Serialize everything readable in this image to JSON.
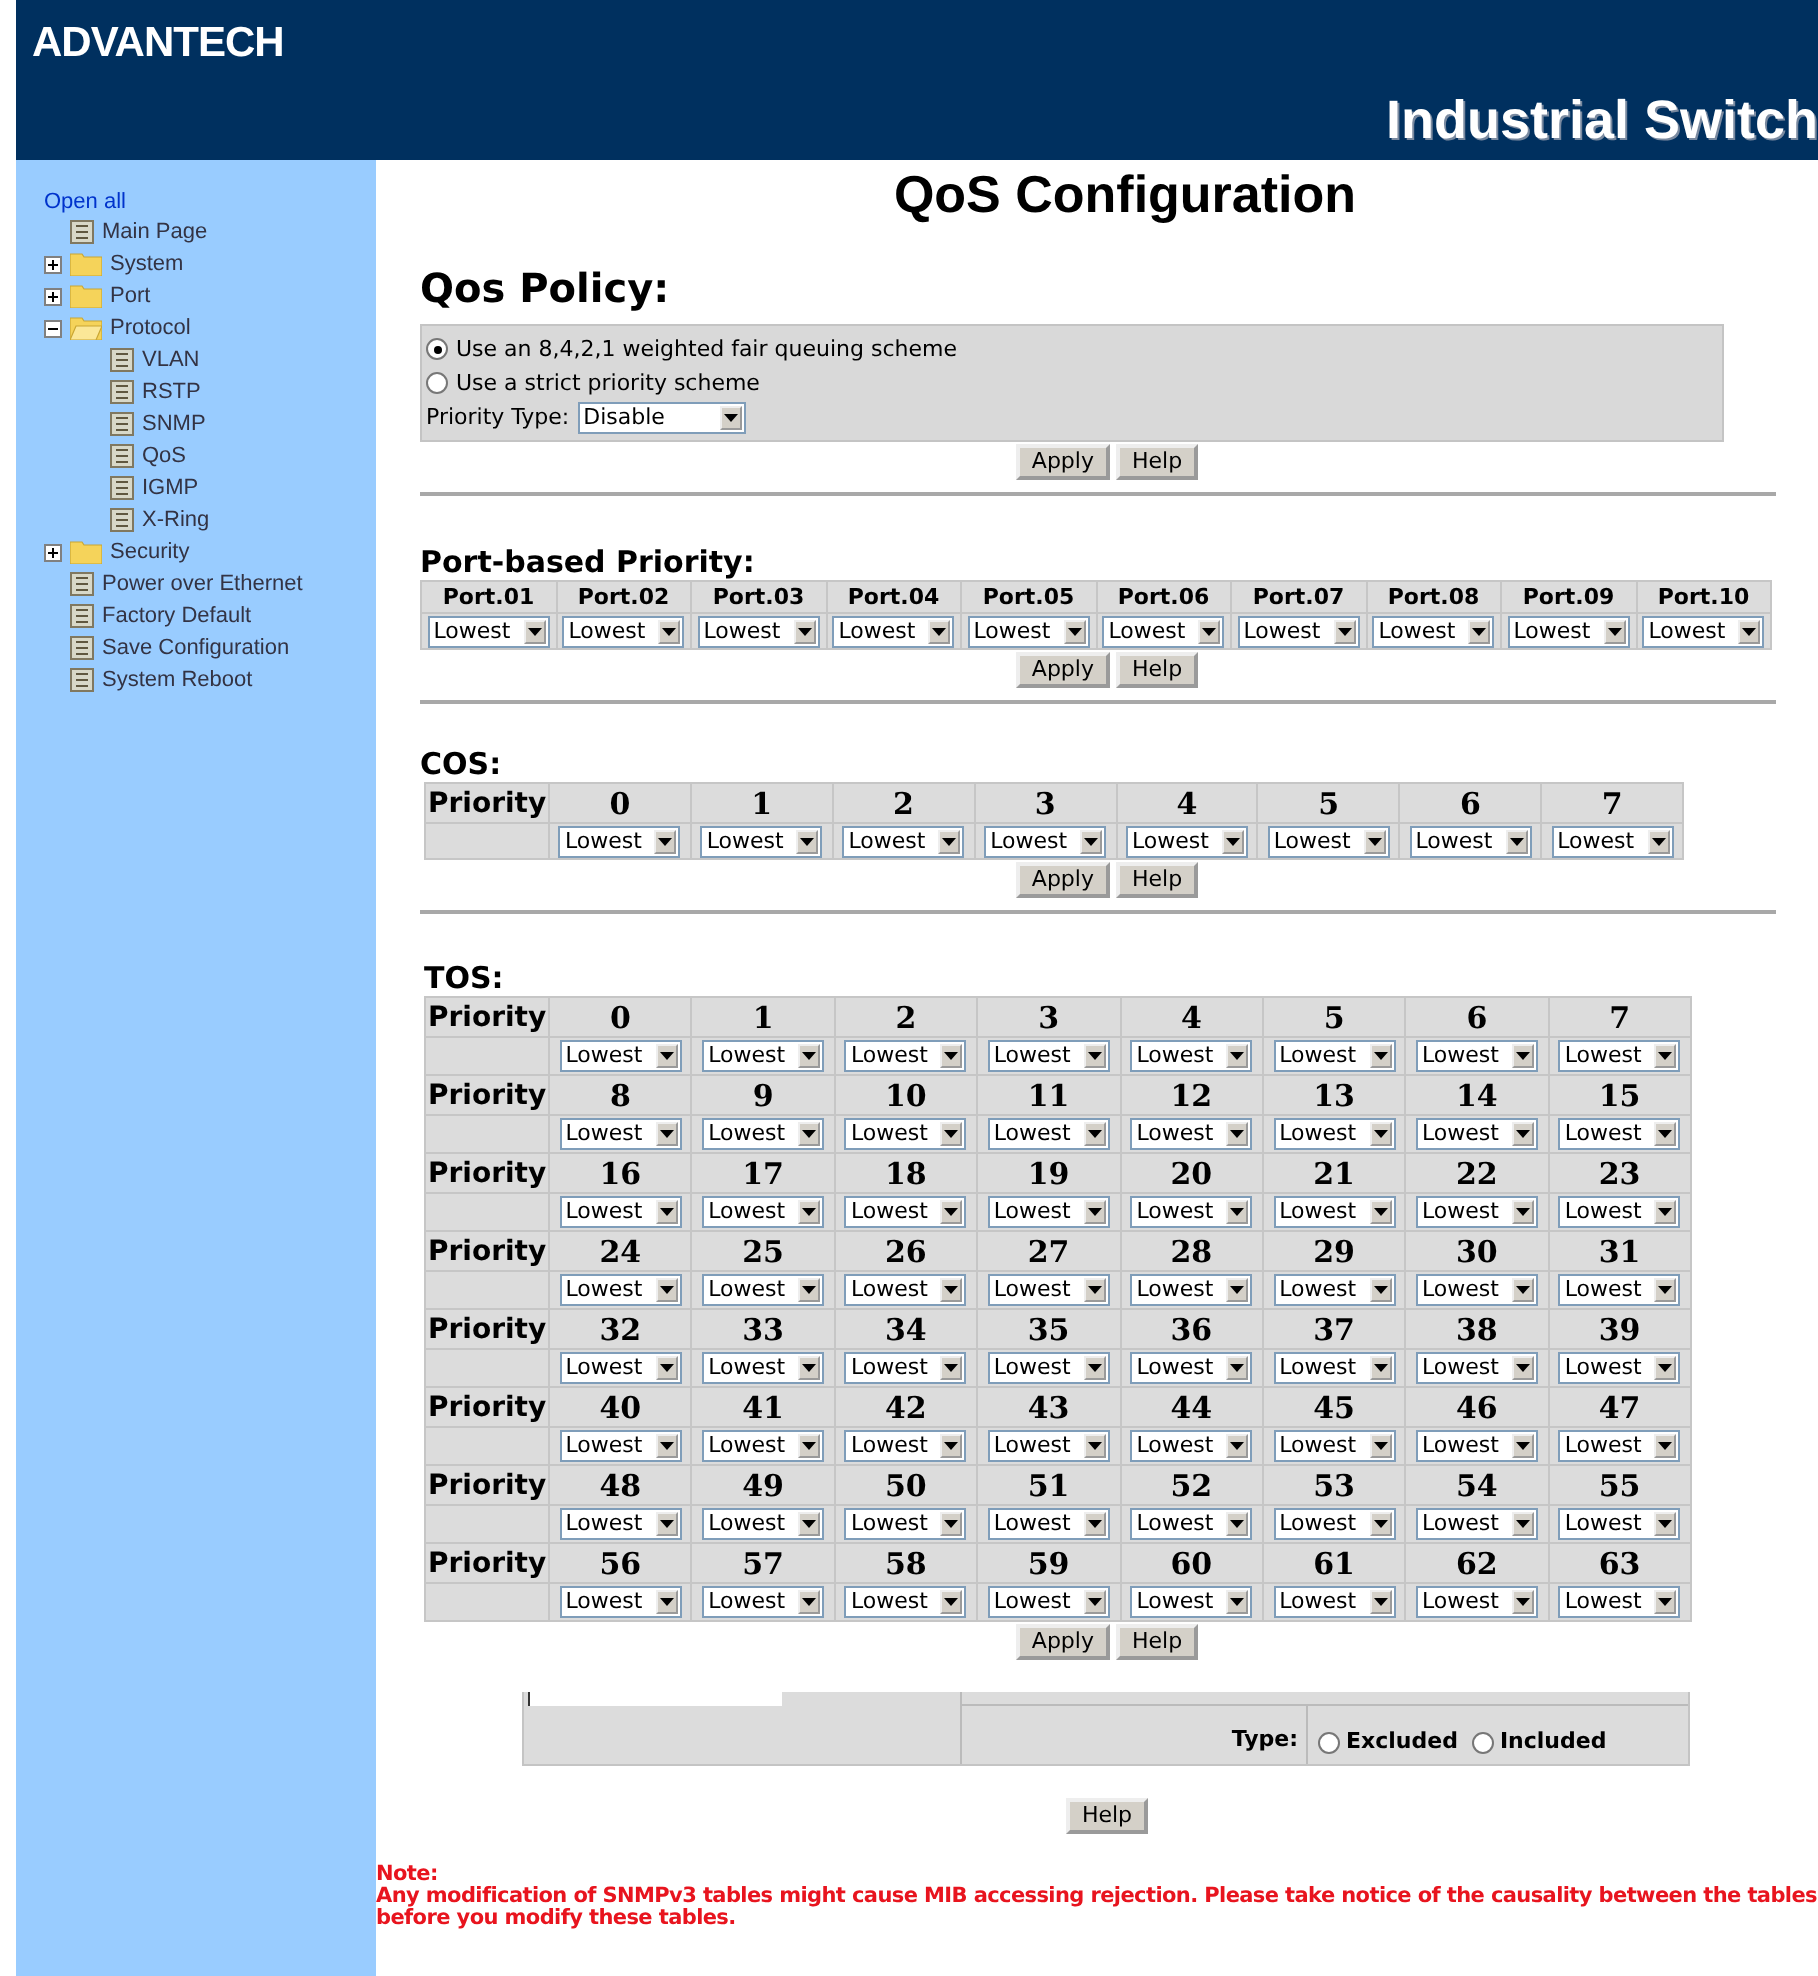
{
  "header": {
    "logo": "ADVANTECH",
    "title": "Industrial Switch"
  },
  "sidebar": {
    "open_all": "Open all",
    "items": [
      {
        "kind": "page",
        "label": "Main Page"
      },
      {
        "kind": "folder",
        "label": "System",
        "expanded": false
      },
      {
        "kind": "folder",
        "label": "Port",
        "expanded": false
      },
      {
        "kind": "folder",
        "label": "Protocol",
        "expanded": true,
        "children": [
          {
            "kind": "page",
            "label": "VLAN"
          },
          {
            "kind": "page",
            "label": "RSTP"
          },
          {
            "kind": "page",
            "label": "SNMP"
          },
          {
            "kind": "page",
            "label": "QoS"
          },
          {
            "kind": "page",
            "label": "IGMP"
          },
          {
            "kind": "page",
            "label": "X-Ring"
          }
        ]
      },
      {
        "kind": "folder",
        "label": "Security",
        "expanded": false
      },
      {
        "kind": "page",
        "label": "Power over Ethernet"
      },
      {
        "kind": "page",
        "label": "Factory Default"
      },
      {
        "kind": "page",
        "label": "Save Configuration"
      },
      {
        "kind": "page",
        "label": "System Reboot"
      }
    ]
  },
  "page_title": "QoS Configuration",
  "qos_policy": {
    "heading": "Qos Policy:",
    "options": [
      {
        "label": "Use an 8,4,2,1 weighted fair queuing scheme",
        "selected": true
      },
      {
        "label": "Use a strict priority scheme",
        "selected": false
      }
    ],
    "priority_type_label": "Priority Type:",
    "priority_type": "Disable",
    "buttons": [
      "Apply",
      "Help"
    ]
  },
  "port_priority": {
    "heading": "Port-based Priority:",
    "ports": [
      {
        "label": "Port.01",
        "value": "Lowest"
      },
      {
        "label": "Port.02",
        "value": "Lowest"
      },
      {
        "label": "Port.03",
        "value": "Lowest"
      },
      {
        "label": "Port.04",
        "value": "Lowest"
      },
      {
        "label": "Port.05",
        "value": "Lowest"
      },
      {
        "label": "Port.06",
        "value": "Lowest"
      },
      {
        "label": "Port.07",
        "value": "Lowest"
      },
      {
        "label": "Port.08",
        "value": "Lowest"
      },
      {
        "label": "Port.09",
        "value": "Lowest"
      },
      {
        "label": "Port.10",
        "value": "Lowest"
      }
    ],
    "buttons": [
      "Apply",
      "Help"
    ]
  },
  "cos": {
    "heading": "COS:",
    "row_label": "Priority",
    "entries": [
      {
        "label": "0",
        "value": "Lowest"
      },
      {
        "label": "1",
        "value": "Lowest"
      },
      {
        "label": "2",
        "value": "Lowest"
      },
      {
        "label": "3",
        "value": "Lowest"
      },
      {
        "label": "4",
        "value": "Lowest"
      },
      {
        "label": "5",
        "value": "Lowest"
      },
      {
        "label": "6",
        "value": "Lowest"
      },
      {
        "label": "7",
        "value": "Lowest"
      }
    ],
    "buttons": [
      "Apply",
      "Help"
    ]
  },
  "tos": {
    "heading": "TOS:",
    "rows": [
      {
        "label": "Priority",
        "entries": [
          {
            "label": "0",
            "value": "Lowest"
          },
          {
            "label": "1",
            "value": "Lowest"
          },
          {
            "label": "2",
            "value": "Lowest"
          },
          {
            "label": "3",
            "value": "Lowest"
          },
          {
            "label": "4",
            "value": "Lowest"
          },
          {
            "label": "5",
            "value": "Lowest"
          },
          {
            "label": "6",
            "value": "Lowest"
          },
          {
            "label": "7",
            "value": "Lowest"
          }
        ]
      },
      {
        "label": "Priority",
        "entries": [
          {
            "label": "8",
            "value": "Lowest"
          },
          {
            "label": "9",
            "value": "Lowest"
          },
          {
            "label": "10",
            "value": "Lowest"
          },
          {
            "label": "11",
            "value": "Lowest"
          },
          {
            "label": "12",
            "value": "Lowest"
          },
          {
            "label": "13",
            "value": "Lowest"
          },
          {
            "label": "14",
            "value": "Lowest"
          },
          {
            "label": "15",
            "value": "Lowest"
          }
        ]
      },
      {
        "label": "Priority",
        "entries": [
          {
            "label": "16",
            "value": "Lowest"
          },
          {
            "label": "17",
            "value": "Lowest"
          },
          {
            "label": "18",
            "value": "Lowest"
          },
          {
            "label": "19",
            "value": "Lowest"
          },
          {
            "label": "20",
            "value": "Lowest"
          },
          {
            "label": "21",
            "value": "Lowest"
          },
          {
            "label": "22",
            "value": "Lowest"
          },
          {
            "label": "23",
            "value": "Lowest"
          }
        ]
      },
      {
        "label": "Priority",
        "entries": [
          {
            "label": "24",
            "value": "Lowest"
          },
          {
            "label": "25",
            "value": "Lowest"
          },
          {
            "label": "26",
            "value": "Lowest"
          },
          {
            "label": "27",
            "value": "Lowest"
          },
          {
            "label": "28",
            "value": "Lowest"
          },
          {
            "label": "29",
            "value": "Lowest"
          },
          {
            "label": "30",
            "value": "Lowest"
          },
          {
            "label": "31",
            "value": "Lowest"
          }
        ]
      },
      {
        "label": "Priority",
        "entries": [
          {
            "label": "32",
            "value": "Lowest"
          },
          {
            "label": "33",
            "value": "Lowest"
          },
          {
            "label": "34",
            "value": "Lowest"
          },
          {
            "label": "35",
            "value": "Lowest"
          },
          {
            "label": "36",
            "value": "Lowest"
          },
          {
            "label": "37",
            "value": "Lowest"
          },
          {
            "label": "38",
            "value": "Lowest"
          },
          {
            "label": "39",
            "value": "Lowest"
          }
        ]
      },
      {
        "label": "Priority",
        "entries": [
          {
            "label": "40",
            "value": "Lowest"
          },
          {
            "label": "41",
            "value": "Lowest"
          },
          {
            "label": "42",
            "value": "Lowest"
          },
          {
            "label": "43",
            "value": "Lowest"
          },
          {
            "label": "44",
            "value": "Lowest"
          },
          {
            "label": "45",
            "value": "Lowest"
          },
          {
            "label": "46",
            "value": "Lowest"
          },
          {
            "label": "47",
            "value": "Lowest"
          }
        ]
      },
      {
        "label": "Priority",
        "entries": [
          {
            "label": "48",
            "value": "Lowest"
          },
          {
            "label": "49",
            "value": "Lowest"
          },
          {
            "label": "50",
            "value": "Lowest"
          },
          {
            "label": "51",
            "value": "Lowest"
          },
          {
            "label": "52",
            "value": "Lowest"
          },
          {
            "label": "53",
            "value": "Lowest"
          },
          {
            "label": "54",
            "value": "Lowest"
          },
          {
            "label": "55",
            "value": "Lowest"
          }
        ]
      },
      {
        "label": "Priority",
        "entries": [
          {
            "label": "56",
            "value": "Lowest"
          },
          {
            "label": "57",
            "value": "Lowest"
          },
          {
            "label": "58",
            "value": "Lowest"
          },
          {
            "label": "59",
            "value": "Lowest"
          },
          {
            "label": "60",
            "value": "Lowest"
          },
          {
            "label": "61",
            "value": "Lowest"
          },
          {
            "label": "62",
            "value": "Lowest"
          },
          {
            "label": "63",
            "value": "Lowest"
          }
        ]
      }
    ],
    "buttons": [
      "Apply",
      "Help"
    ]
  },
  "snmp_fragment": {
    "type_label": "Type:",
    "options": [
      {
        "label": "Excluded",
        "selected": false
      },
      {
        "label": "Included",
        "selected": false
      }
    ]
  },
  "help_button": "Help",
  "note": {
    "title": "Note:",
    "text": "Any modification of SNMPv3 tables might cause MIB accessing rejection. Please take notice of the causality between the tables before you modify these tables."
  }
}
